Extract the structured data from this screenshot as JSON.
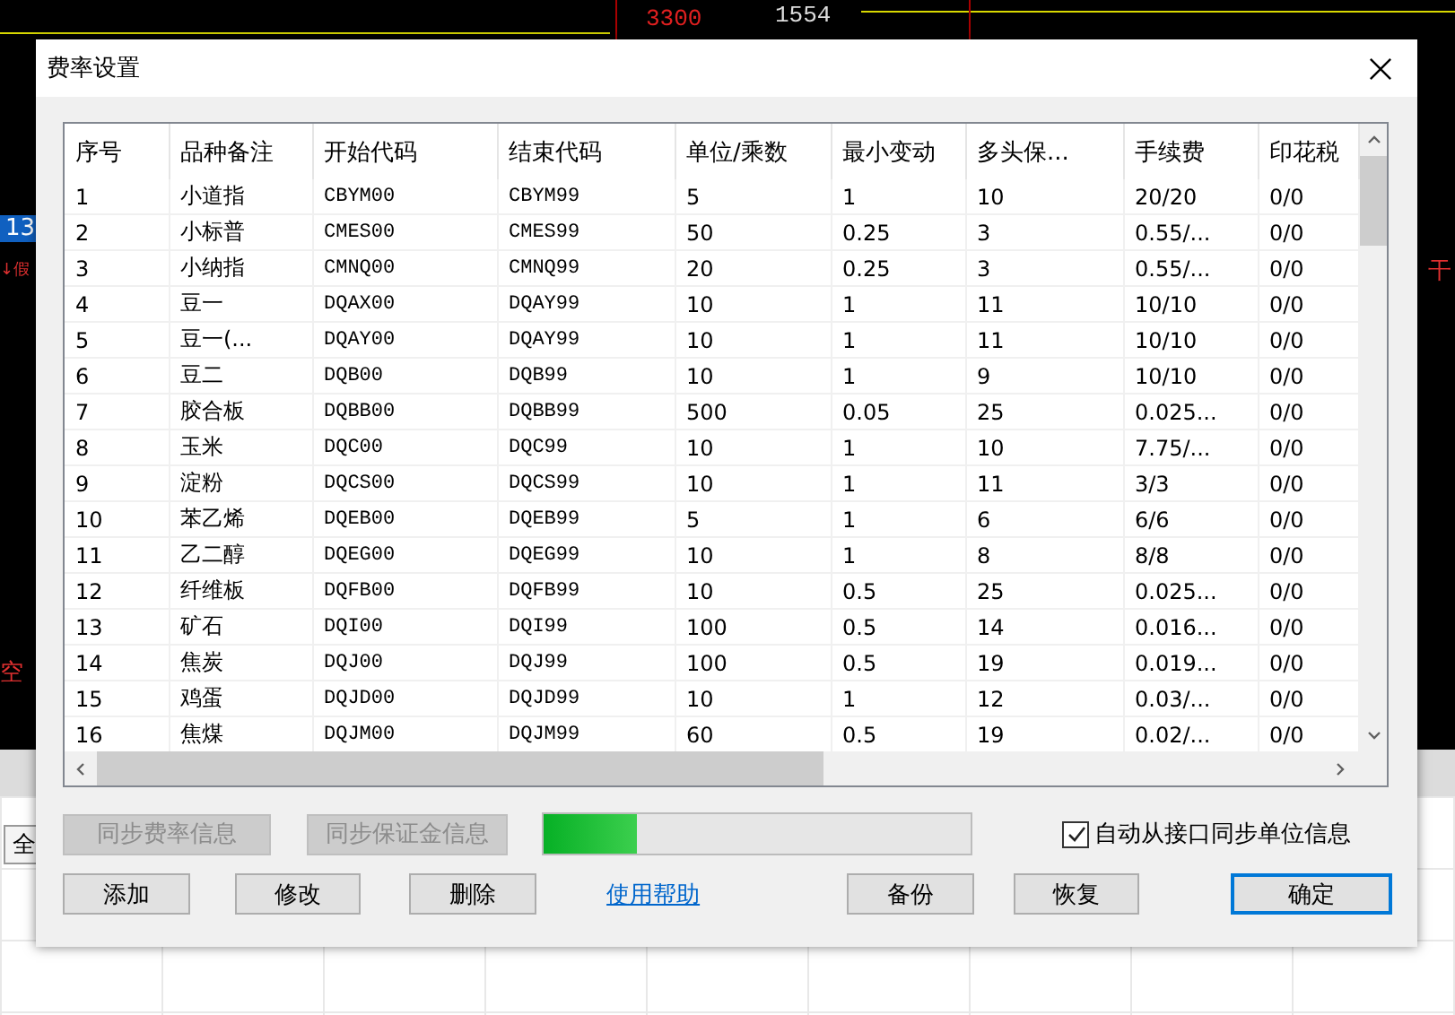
{
  "background": {
    "labels": [
      {
        "kind": "price",
        "text": "3300"
      },
      {
        "kind": "price",
        "text": "1554"
      },
      {
        "kind": "tag",
        "text": "13"
      },
      {
        "kind": "mark",
        "text": "↓假"
      },
      {
        "kind": "mark",
        "text": "干"
      },
      {
        "kind": "mark",
        "text": "空"
      },
      {
        "kind": "button",
        "text": "全"
      }
    ]
  },
  "dialog": {
    "title": "费率设置",
    "table": {
      "columns": [
        "序号",
        "品种备注",
        "开始代码",
        "结束代码",
        "单位/乘数",
        "最小变动",
        "多头保...",
        "手续费",
        "印花税"
      ],
      "rows": [
        [
          "1",
          "小道指",
          "CBYM00",
          "CBYM99",
          "5",
          "1",
          "10",
          "20/20",
          "0/0"
        ],
        [
          "2",
          "小标普",
          "CMES00",
          "CMES99",
          "50",
          "0.25",
          "3",
          "0.55/...",
          "0/0"
        ],
        [
          "3",
          "小纳指",
          "CMNQ00",
          "CMNQ99",
          "20",
          "0.25",
          "3",
          "0.55/...",
          "0/0"
        ],
        [
          "4",
          "豆一",
          "DQAX00",
          "DQAY99",
          "10",
          "1",
          "11",
          "10/10",
          "0/0"
        ],
        [
          "5",
          "豆一(...",
          "DQAY00",
          "DQAY99",
          "10",
          "1",
          "11",
          "10/10",
          "0/0"
        ],
        [
          "6",
          "豆二",
          "DQB00",
          "DQB99",
          "10",
          "1",
          "9",
          "10/10",
          "0/0"
        ],
        [
          "7",
          "胶合板",
          "DQBB00",
          "DQBB99",
          "500",
          "0.05",
          "25",
          "0.025...",
          "0/0"
        ],
        [
          "8",
          "玉米",
          "DQC00",
          "DQC99",
          "10",
          "1",
          "10",
          "7.75/...",
          "0/0"
        ],
        [
          "9",
          "淀粉",
          "DQCS00",
          "DQCS99",
          "10",
          "1",
          "11",
          "3/3",
          "0/0"
        ],
        [
          "10",
          "苯乙烯",
          "DQEB00",
          "DQEB99",
          "5",
          "1",
          "6",
          "6/6",
          "0/0"
        ],
        [
          "11",
          "乙二醇",
          "DQEG00",
          "DQEG99",
          "10",
          "1",
          "8",
          "8/8",
          "0/0"
        ],
        [
          "12",
          "纤维板",
          "DQFB00",
          "DQFB99",
          "10",
          "0.5",
          "25",
          "0.025...",
          "0/0"
        ],
        [
          "13",
          "矿石",
          "DQI00",
          "DQI99",
          "100",
          "0.5",
          "14",
          "0.016...",
          "0/0"
        ],
        [
          "14",
          "焦炭",
          "DQJ00",
          "DQJ99",
          "100",
          "0.5",
          "19",
          "0.019...",
          "0/0"
        ],
        [
          "15",
          "鸡蛋",
          "DQJD00",
          "DQJD99",
          "10",
          "1",
          "12",
          "0.03/...",
          "0/0"
        ],
        [
          "16",
          "焦煤",
          "DQJM00",
          "DQJM99",
          "60",
          "0.5",
          "19",
          "0.02/...",
          "0/0"
        ]
      ]
    },
    "sync_buttons": [
      {
        "label": "同步费率信息",
        "disabled": true
      },
      {
        "label": "同步保证金信息",
        "disabled": true
      }
    ],
    "progress": {
      "level": 0.22
    },
    "auto_sync": {
      "label": "自动从接口同步单位信息",
      "checked": true
    },
    "actions": [
      {
        "kind": "button",
        "label": "添加",
        "focused": false
      },
      {
        "kind": "button",
        "label": "修改",
        "focused": false
      },
      {
        "kind": "button",
        "label": "删除",
        "focused": false
      },
      {
        "kind": "link",
        "label": "使用帮助",
        "focused": false
      },
      {
        "kind": "button",
        "label": "备份",
        "focused": false
      },
      {
        "kind": "button",
        "label": "恢复",
        "focused": false
      },
      {
        "kind": "button",
        "label": "确定",
        "focused": true
      }
    ]
  }
}
